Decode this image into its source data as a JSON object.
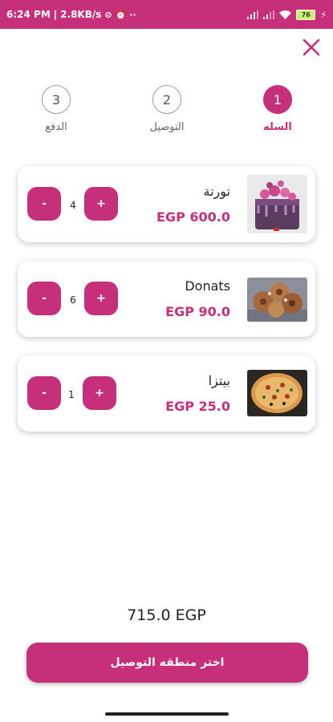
{
  "status_bar": {
    "time": "6:24 PM",
    "network_speed": "2.8KB/s",
    "battery_level": "76"
  },
  "steps": [
    {
      "number": "1",
      "label": "السله",
      "active": true
    },
    {
      "number": "2",
      "label": "التوصيل",
      "active": false
    },
    {
      "number": "3",
      "label": "الدفع",
      "active": false
    }
  ],
  "cart": {
    "items": [
      {
        "name": "تورتة",
        "price": "EGP 600.0",
        "quantity": "4",
        "image": "cake-image"
      },
      {
        "name": "Donats",
        "price": "EGP 90.0",
        "quantity": "6",
        "image": "donuts-image"
      },
      {
        "name": "بيتزا",
        "price": "EGP 25.0",
        "quantity": "1",
        "image": "pizza-image"
      }
    ],
    "minus_label": "-",
    "plus_label": "+"
  },
  "total": "715.0 EGP",
  "cta_label": "اختر منطقه التوصيل",
  "colors": {
    "accent": "#c6307a"
  }
}
